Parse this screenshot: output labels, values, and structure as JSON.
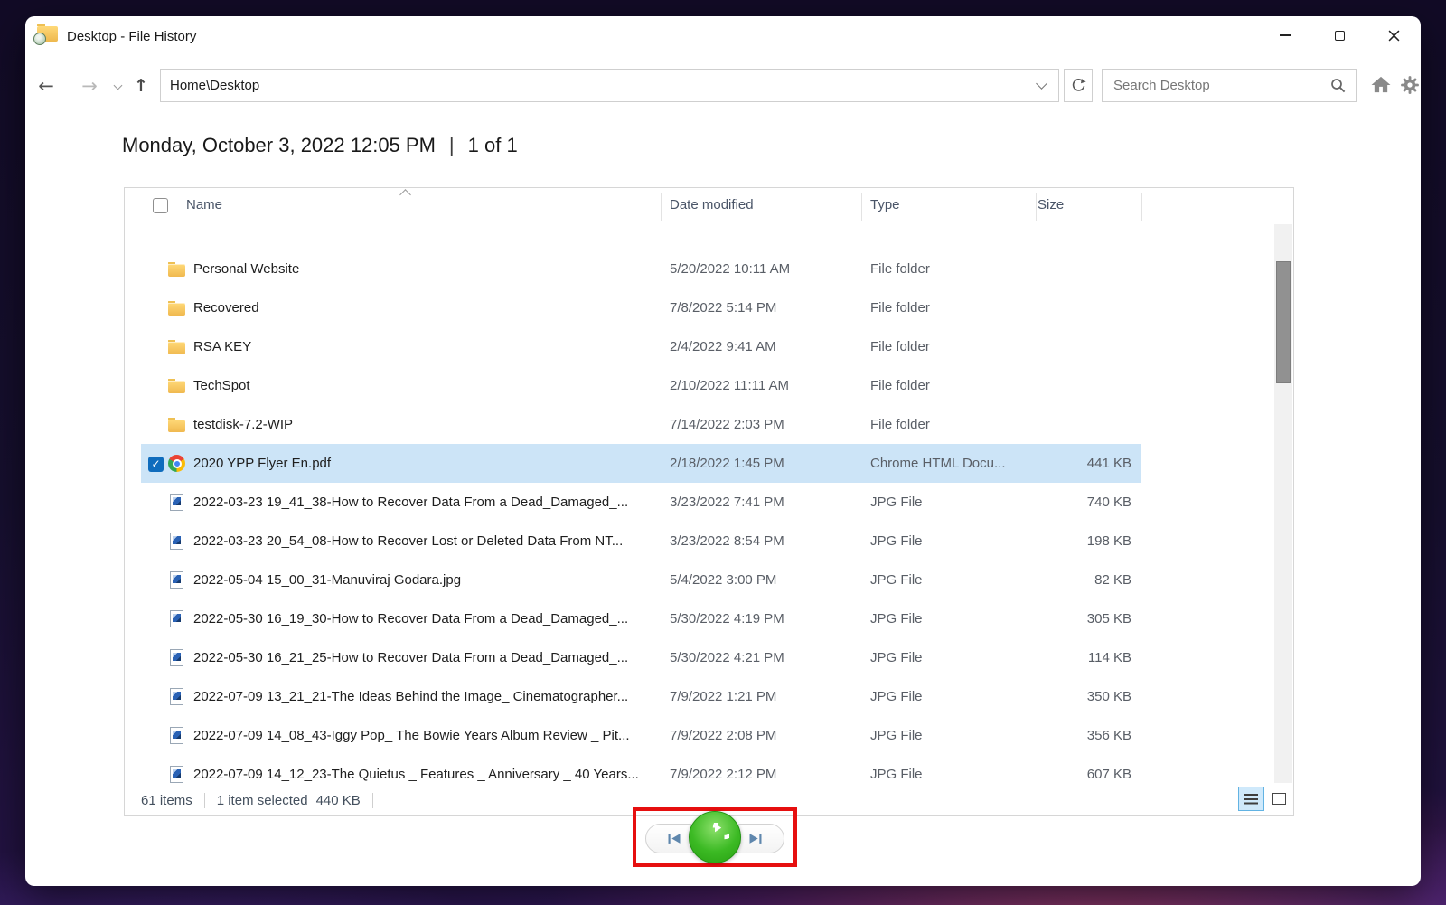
{
  "window": {
    "title": "Desktop - File History"
  },
  "toolbar": {
    "address_value": "Home\\Desktop",
    "search_placeholder": "Search Desktop"
  },
  "timeline": {
    "date": "Monday, October 3, 2022 12:05 PM",
    "separator": "|",
    "position": "1 of 1"
  },
  "list": {
    "columns": {
      "name": "Name",
      "date": "Date modified",
      "type": "Type",
      "size": "Size"
    },
    "rows": [
      {
        "name": "Personal Website",
        "date": "5/20/2022 10:11 AM",
        "type": "File folder",
        "size": "",
        "icon": "folder",
        "selected": false
      },
      {
        "name": "Recovered",
        "date": "7/8/2022 5:14 PM",
        "type": "File folder",
        "size": "",
        "icon": "folder",
        "selected": false
      },
      {
        "name": "RSA KEY",
        "date": "2/4/2022 9:41 AM",
        "type": "File folder",
        "size": "",
        "icon": "folder",
        "selected": false
      },
      {
        "name": "TechSpot",
        "date": "2/10/2022 11:11 AM",
        "type": "File folder",
        "size": "",
        "icon": "folder",
        "selected": false
      },
      {
        "name": "testdisk-7.2-WIP",
        "date": "7/14/2022 2:03 PM",
        "type": "File folder",
        "size": "",
        "icon": "folder",
        "selected": false
      },
      {
        "name": "2020 YPP Flyer En.pdf",
        "date": "2/18/2022 1:45 PM",
        "type": "Chrome HTML Docu...",
        "size": "441 KB",
        "icon": "chrome",
        "selected": true
      },
      {
        "name": "2022-03-23 19_41_38-How to Recover Data From a Dead_Damaged_...",
        "date": "3/23/2022 7:41 PM",
        "type": "JPG File",
        "size": "740 KB",
        "icon": "jpg",
        "selected": false
      },
      {
        "name": "2022-03-23 20_54_08-How to Recover Lost or Deleted Data From NT...",
        "date": "3/23/2022 8:54 PM",
        "type": "JPG File",
        "size": "198 KB",
        "icon": "jpg",
        "selected": false
      },
      {
        "name": "2022-05-04 15_00_31-Manuviraj Godara.jpg",
        "date": "5/4/2022 3:00 PM",
        "type": "JPG File",
        "size": "82 KB",
        "icon": "jpg",
        "selected": false
      },
      {
        "name": "2022-05-30 16_19_30-How to Recover Data From a Dead_Damaged_...",
        "date": "5/30/2022 4:19 PM",
        "type": "JPG File",
        "size": "305 KB",
        "icon": "jpg",
        "selected": false
      },
      {
        "name": "2022-05-30 16_21_25-How to Recover Data From a Dead_Damaged_...",
        "date": "5/30/2022 4:21 PM",
        "type": "JPG File",
        "size": "114 KB",
        "icon": "jpg",
        "selected": false
      },
      {
        "name": "2022-07-09 13_21_21-The Ideas Behind the Image_ Cinematographer...",
        "date": "7/9/2022 1:21 PM",
        "type": "JPG File",
        "size": "350 KB",
        "icon": "jpg",
        "selected": false
      },
      {
        "name": "2022-07-09 14_08_43-Iggy Pop_ The Bowie Years Album Review _ Pit...",
        "date": "7/9/2022 2:08 PM",
        "type": "JPG File",
        "size": "356 KB",
        "icon": "jpg",
        "selected": false
      },
      {
        "name": "2022-07-09 14_12_23-The Quietus _ Features _ Anniversary _ 40 Years...",
        "date": "7/9/2022 2:12 PM",
        "type": "JPG File",
        "size": "607 KB",
        "icon": "jpg",
        "selected": false
      }
    ]
  },
  "status": {
    "items": "61 items",
    "selected": "1 item selected",
    "selected_size": "440 KB"
  },
  "icons": {
    "back": "←",
    "forward": "→",
    "up": "↑",
    "check": "✓"
  },
  "colors": {
    "selection_bg": "#cce4f7",
    "highlight_box": "#e60f0f",
    "restore_green": "#3cba24",
    "folder_yellow": "#f0b94f"
  }
}
